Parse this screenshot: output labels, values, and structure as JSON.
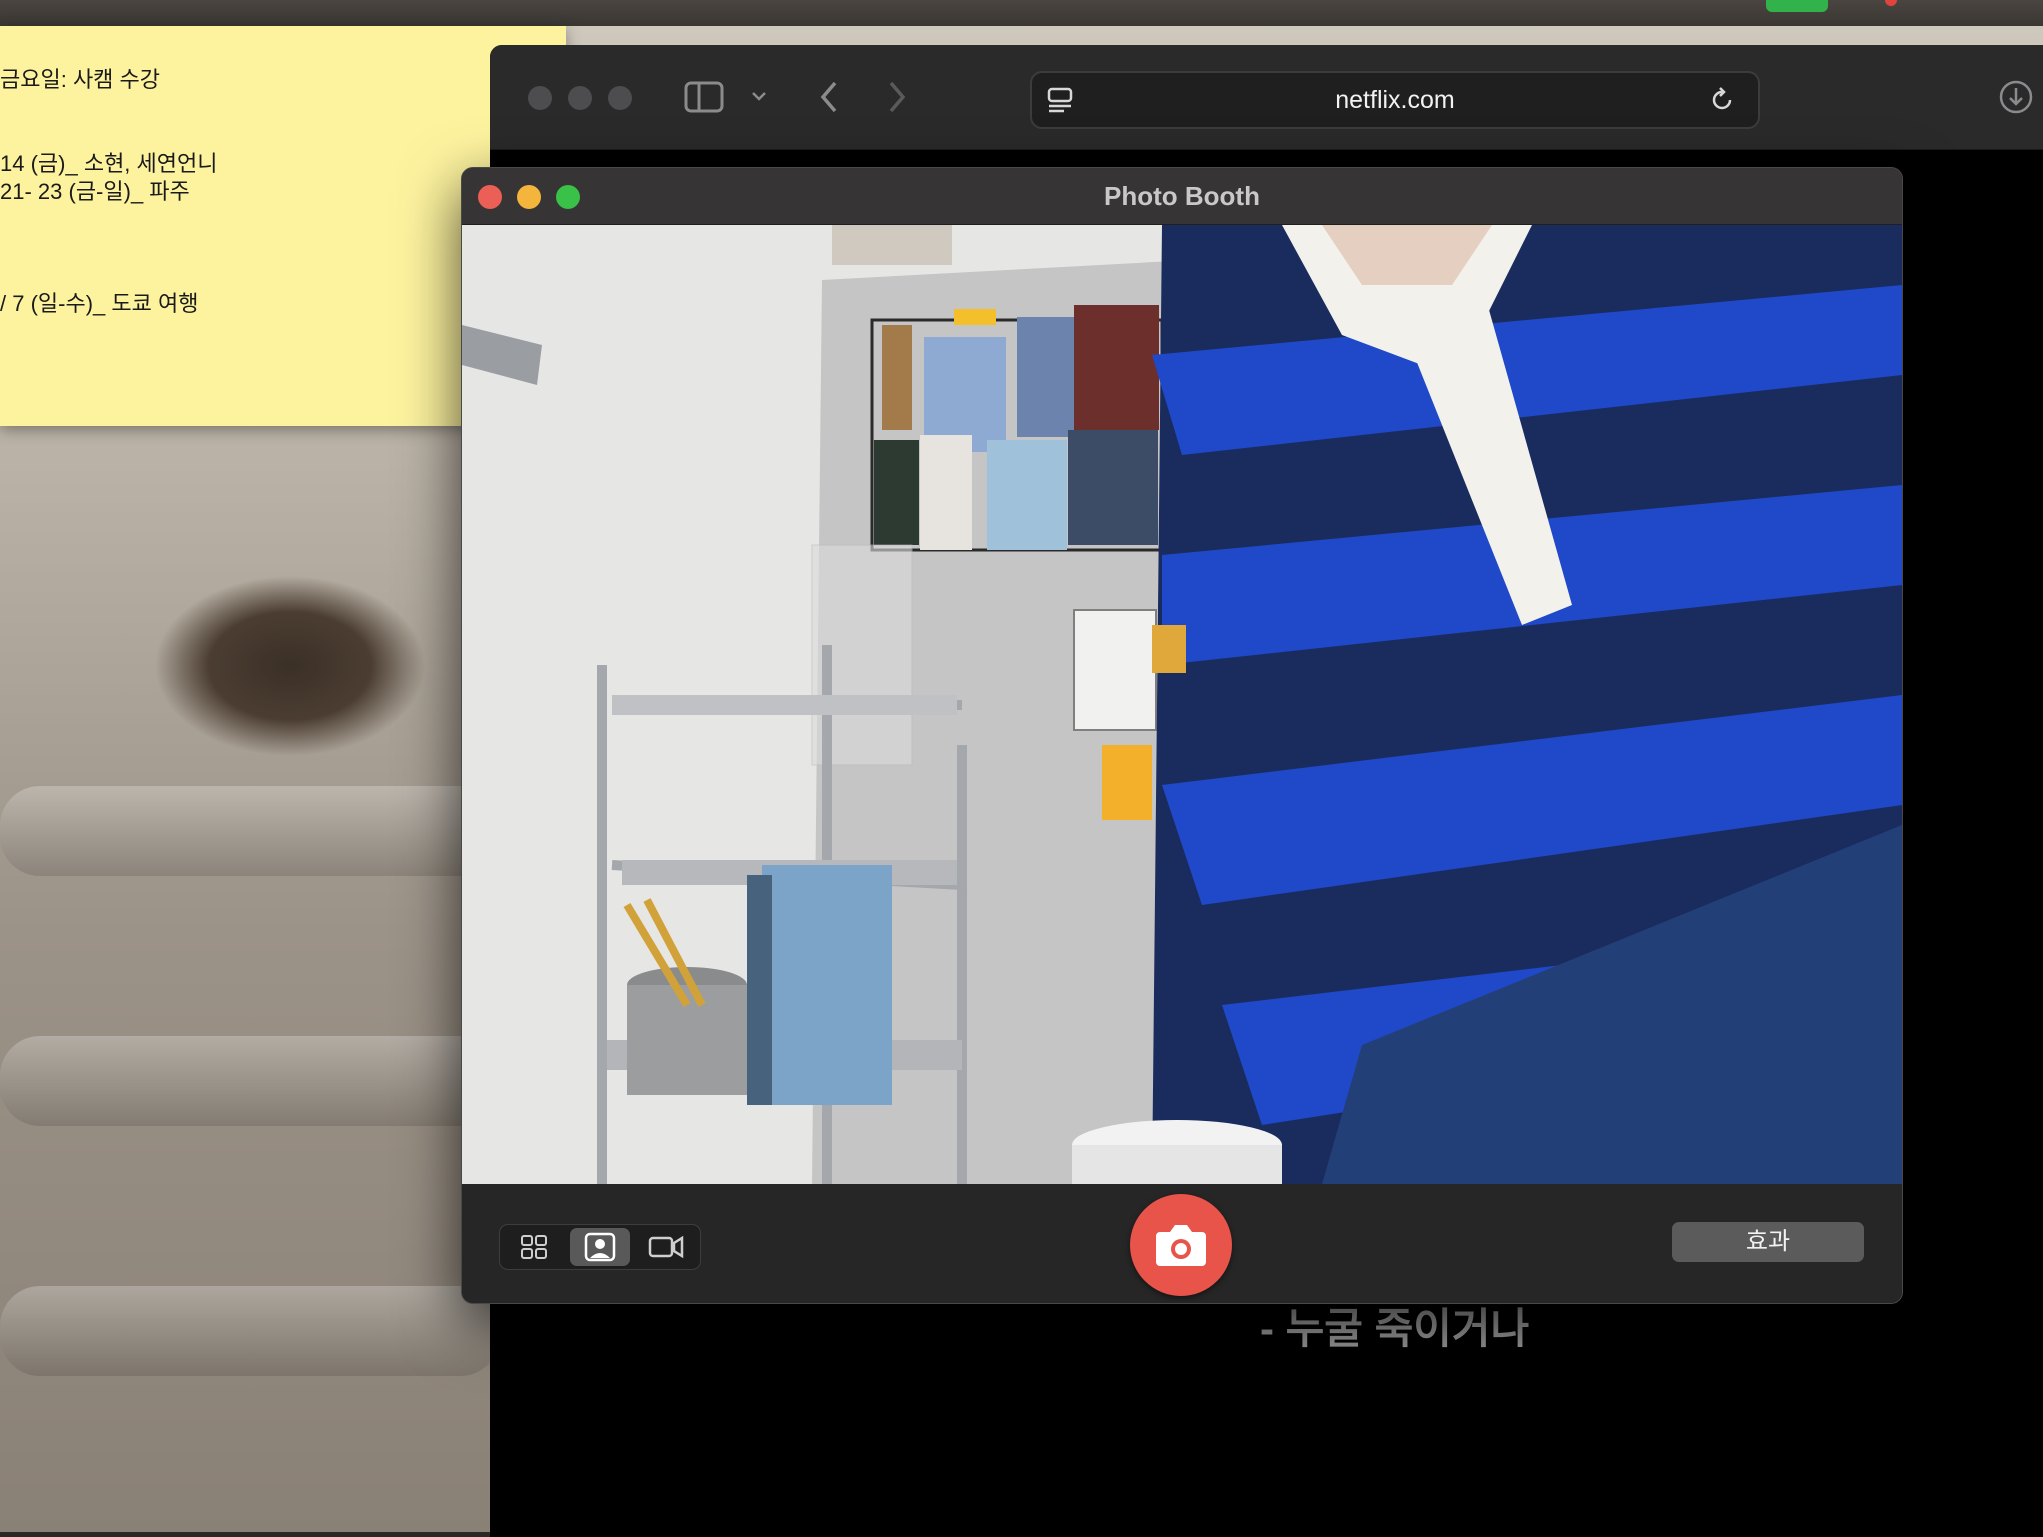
{
  "sticky_note": {
    "lines": [
      "금요일: 사캠 수강",
      "14 (금)_ 소현, 세연언니",
      "21- 23 (금-일)_ 파주",
      "/ 7 (일-수)_ 도쿄 여행"
    ]
  },
  "browser": {
    "url": "netflix.com",
    "subtitle": "- 누굴 죽이거나",
    "icons": [
      "sidebar-icon",
      "chevron-down-icon",
      "back-icon",
      "forward-icon",
      "page-menu-icon",
      "reload-icon",
      "download-icon"
    ]
  },
  "photo_booth": {
    "title": "Photo Booth",
    "modes": [
      "grid-mode",
      "photo-mode",
      "video-mode"
    ],
    "selected_mode": "photo-mode",
    "shutter_icon": "camera-icon",
    "effects_label": "효과"
  },
  "colors": {
    "sticky": "#fdf39f",
    "shutter": "#e8534a",
    "close": "#ec5f57",
    "minimize": "#f3b53b",
    "zoom": "#39c148"
  }
}
